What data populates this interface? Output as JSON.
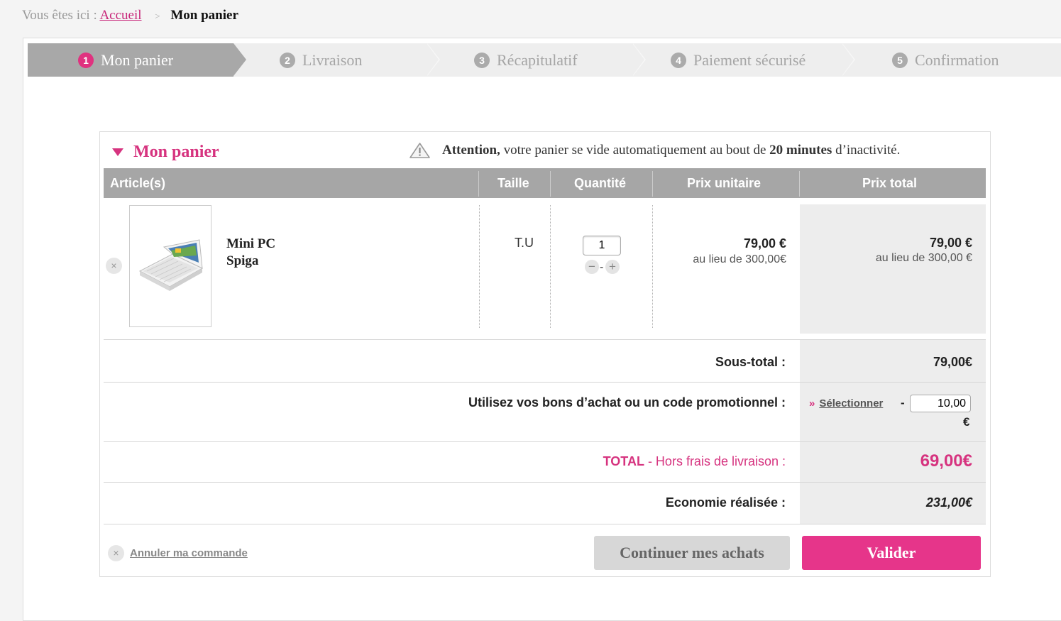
{
  "breadcrumb": {
    "prefix": "Vous êtes ici :",
    "home": "Accueil",
    "separator": ">",
    "current": "Mon panier"
  },
  "steps": [
    {
      "num": "1",
      "label": "Mon panier",
      "active": true
    },
    {
      "num": "2",
      "label": "Livraison",
      "active": false
    },
    {
      "num": "3",
      "label": "Récapitulatif",
      "active": false
    },
    {
      "num": "4",
      "label": "Paiement sécurisé",
      "active": false
    },
    {
      "num": "5",
      "label": "Confirmation",
      "active": false
    }
  ],
  "cart": {
    "title": "Mon panier",
    "warning": {
      "icon": "warning-triangle-icon",
      "bold1": "Attention,",
      "text1": " votre panier se vide automatiquement au bout de ",
      "bold2": "20 minutes",
      "text2": " d’inactivité."
    },
    "columns": [
      "Article(s)",
      "Taille",
      "Quantité",
      "Prix unitaire",
      "Prix total"
    ],
    "item": {
      "name_line1": "Mini PC",
      "name_line2": "Spiga",
      "size": "T.U",
      "quantity": "1",
      "unit_price": "79,00 €",
      "unit_price_old": "au lieu de 300,00€",
      "total_price": "79,00 €",
      "total_price_old": "au lieu de 300,00 €",
      "remove_glyph": "×",
      "minus_glyph": "−",
      "plus_glyph": "+",
      "qty_dash": "-"
    },
    "subtotal_label": "Sous-total :",
    "subtotal_value": "79,00€",
    "promo_label": "Utilisez vos bons d’achat ou un code promotionnel :",
    "promo_select_arrows": "»",
    "promo_select": "Sélectionner",
    "promo_minus": "-",
    "promo_value": "10,00",
    "promo_currency": "€",
    "total_label_bold": "TOTAL",
    "total_label_rest": " - Hors frais de livraison :",
    "total_value": "69,00€",
    "savings_label": "Economie réalisée :",
    "savings_value": "231,00€",
    "cancel_glyph": "×",
    "cancel_label": "Annuler ma commande",
    "continue_label": "Continuer mes achats",
    "validate_label": "Valider"
  },
  "colors": {
    "accent": "#e6358a",
    "header_grey": "#a6a6a6"
  }
}
